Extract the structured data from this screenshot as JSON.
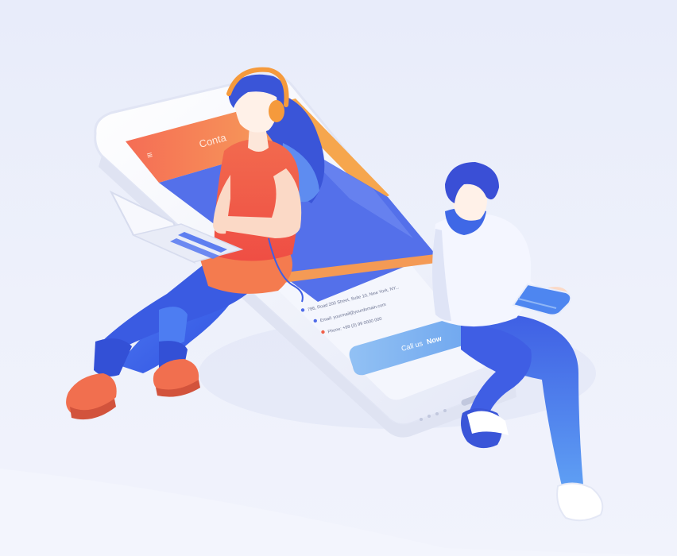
{
  "screen": {
    "header_title": "Conta",
    "menu_glyph": "≡",
    "contact_lines": [
      "786, Road 200 Street, Suite 10, New York, NY...",
      "Email: yourmail@yourdomain.com",
      "Phone: +99 (0) 99 0000 000"
    ],
    "button_label_prefix": "Call us",
    "button_label_bold": "Now"
  },
  "colors": {
    "background": "#eef1fb",
    "phone_body": "#f7f8fd",
    "screen_header": "#f7805a",
    "screen_panel": "#4f6be8",
    "screen_accent": "#f4a14b",
    "button": "#7eb2f0",
    "woman_shirt": "#f4604a",
    "woman_headphones": "#f59a3c",
    "pants": "#3e63e6",
    "man_hoodie": "#f4f6ff",
    "shoes": "#f16f4f"
  },
  "icons": {
    "menu": "hamburger-icon",
    "bullets": [
      "location-bullet-icon",
      "email-bullet-icon",
      "phone-bullet-icon"
    ]
  }
}
